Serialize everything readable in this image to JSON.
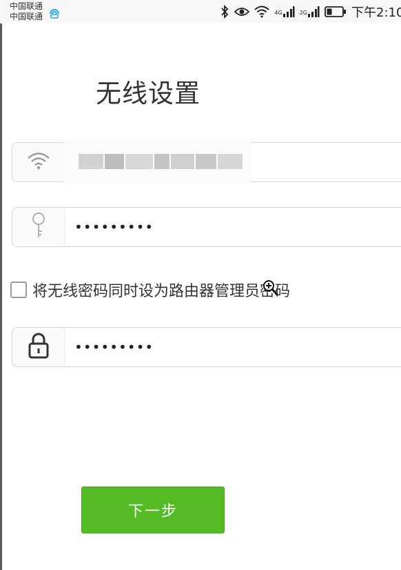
{
  "status_bar": {
    "carrier_1": "中国联通",
    "carrier_2": "中国联通",
    "network_4g": "4G",
    "network_2g": "2G",
    "time": "下午2:10",
    "icons": [
      "hotspot-icon",
      "bluetooth-icon",
      "eye-icon",
      "wifi-icon",
      "signal-icon",
      "signal-icon",
      "battery-icon"
    ]
  },
  "page": {
    "title": "无线设置"
  },
  "form": {
    "ssid_value": "",
    "wifi_password_value": "•••••••••",
    "sync_checkbox_label": "将无线密码同时设为路由器管理员密码",
    "sync_checkbox_checked": false,
    "admin_password_value": "•••••••••",
    "field_icons": [
      "wifi-icon",
      "key-icon",
      "lock-icon"
    ]
  },
  "actions": {
    "next_label": "下一步"
  },
  "colors": {
    "primary_button": "#55bb24",
    "field_border": "#d6d6d6",
    "text": "#333333"
  }
}
